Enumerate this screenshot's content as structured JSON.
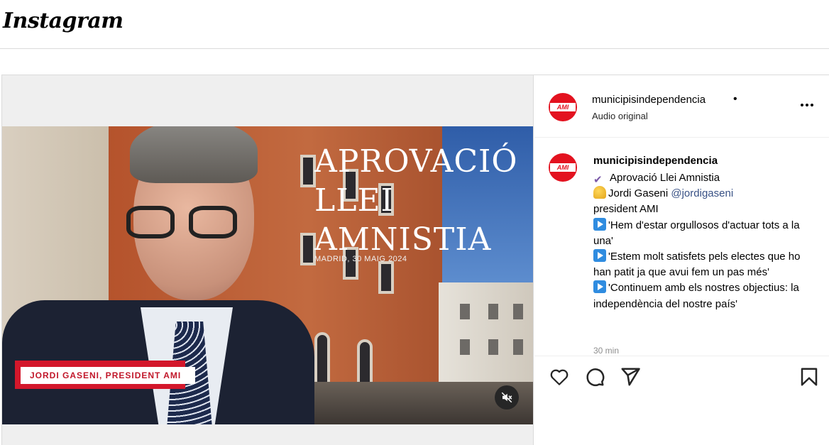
{
  "app": {
    "logo": "Instagram"
  },
  "video": {
    "headline_lines": [
      "APROVACIÓ",
      "LLEI",
      "AMNISTIA"
    ],
    "subhead": "MADRID, 30 MAIG 2024",
    "lower_third": "JORDI GASENI, PRESIDENT AMI",
    "accent_color": "#d3172b"
  },
  "post": {
    "username": "municipisindependencia",
    "dot": "•",
    "audio": "Audio original",
    "avatar_text": "AMI",
    "brand_color": "#e3121f",
    "caption": {
      "username": "municipisindependencia",
      "line1": "Aprovació Llei Amnistia",
      "line2_text": "Jordi Gaseni ",
      "line2_mention": "@jordigaseni",
      "line3": "president AMI",
      "line4": "'Hem d'estar orgullosos d'actuar tots a la una'",
      "line5": "'Estem molt satisfets pels electes que ho han patit ja que avui fem un pas més'",
      "line6": "'Continuem amb els nostres objectius: la independència del nostre país'"
    },
    "timestamp": "30 min"
  },
  "icons": {
    "check": "heavy-check-mark-emoji",
    "bell": "bell-emoji",
    "play": "play-button-emoji",
    "mute": "speaker-muted-icon",
    "like": "heart-icon",
    "comment": "comment-icon",
    "share": "paper-plane-icon",
    "save": "bookmark-icon",
    "more": "more-options-icon"
  }
}
